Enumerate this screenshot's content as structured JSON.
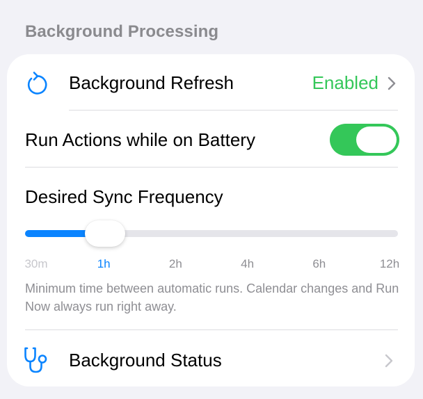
{
  "section": {
    "title": "Background Processing"
  },
  "refresh": {
    "icon": "refresh-icon",
    "label": "Background Refresh",
    "value": "Enabled"
  },
  "battery": {
    "label": "Run Actions while on Battery",
    "toggle_on": true
  },
  "sync": {
    "label": "Desired Sync Frequency",
    "ticks": [
      "30m",
      "1h",
      "2h",
      "4h",
      "6h",
      "12h"
    ],
    "selected": "1h",
    "selected_index": 1,
    "footnote": "Minimum time between automatic runs. Calendar changes and Run Now always run right away."
  },
  "status": {
    "icon": "stethoscope-icon",
    "label": "Background Status"
  },
  "colors": {
    "accent": "#0a84ff",
    "enabled": "#34c759",
    "secondary": "#8e8e93"
  }
}
